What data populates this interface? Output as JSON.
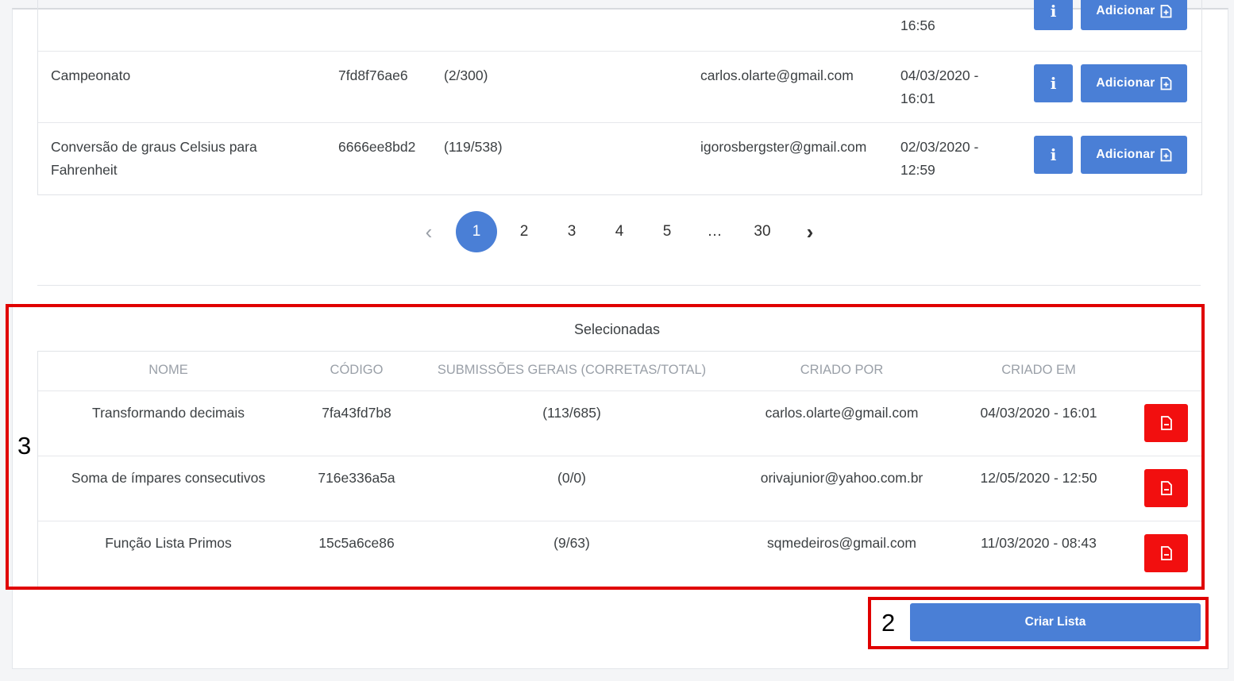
{
  "upper_table": {
    "partial_row": {
      "date_line2": "16:56",
      "add_label": "Adicionar"
    },
    "rows": [
      {
        "name_line1": "Campeonato",
        "name_line2": "",
        "code": "7fd8f76ae6",
        "submissions": "(2/300)",
        "author": "carlos.olarte@gmail.com",
        "date_line1": "04/03/2020 -",
        "date_line2": "16:01",
        "info_label": "i",
        "add_label": "Adicionar"
      },
      {
        "name_line1": "Conversão de graus Celsius para",
        "name_line2": "Fahrenheit",
        "code": "6666ee8bd2",
        "submissions": "(119/538)",
        "author": "igorosbergster@gmail.com",
        "date_line1": "02/03/2020 -",
        "date_line2": "12:59",
        "info_label": "i",
        "add_label": "Adicionar"
      }
    ]
  },
  "pagination": {
    "prev": "‹",
    "pages": [
      "1",
      "2",
      "3",
      "4",
      "5",
      "…",
      "30"
    ],
    "active": "1",
    "next": "›"
  },
  "selected": {
    "title": "Selecionadas",
    "headers": {
      "name": "NOME",
      "code": "CÓDIGO",
      "submissions": "SUBMISSÕES GERAIS (CORRETAS/TOTAL)",
      "author": "CRIADO POR",
      "created": "CRIADO EM"
    },
    "rows": [
      {
        "name": "Transformando decimais",
        "code": "7fa43fd7b8",
        "submissions": "(113/685)",
        "author": "carlos.olarte@gmail.com",
        "created": "04/03/2020 - 16:01"
      },
      {
        "name": "Soma de ímpares consecutivos",
        "code": "716e336a5a",
        "submissions": "(0/0)",
        "author": "orivajunior@yahoo.com.br",
        "created": "12/05/2020 - 12:50"
      },
      {
        "name": "Função Lista Primos",
        "code": "15c5a6ce86",
        "submissions": "(9/63)",
        "author": "sqmedeiros@gmail.com",
        "created": "11/03/2020 - 08:43"
      }
    ]
  },
  "create_button": {
    "label": "Criar Lista"
  },
  "annotations": {
    "box3": "3",
    "box2": "2"
  },
  "colors": {
    "primary": "#4a7fd6",
    "danger": "#f20f0f",
    "annotation": "#e00000"
  },
  "icons": {
    "info": "info-icon",
    "add": "file-plus-icon",
    "remove": "file-minus-icon",
    "prev": "chevron-left-icon",
    "next": "chevron-right-icon"
  }
}
